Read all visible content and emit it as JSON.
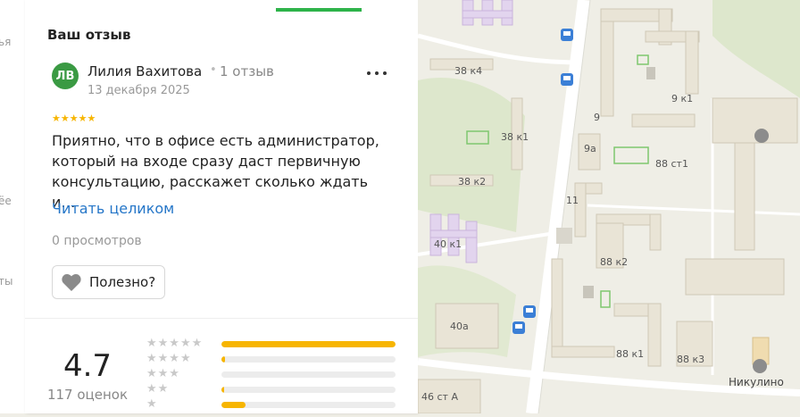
{
  "left_sliver": {
    "fragments": [
      "ья",
      "ёе",
      "ты"
    ]
  },
  "review": {
    "section_title": "Ваш отзыв",
    "avatar_initials": "ЛВ",
    "author": "Лилия Вахитова",
    "separator": "•",
    "reviews_count": "1 отзыв",
    "date": "13 декабря 2025",
    "stars": "★★★★★",
    "text": "Приятно, что в офисе есть администратор, который на входе сразу даст первичную консультацию, расскажет сколько ждать и…",
    "read_more": "Читать целиком",
    "views": "0 просмотров",
    "useful_label": "Полезно?"
  },
  "summary": {
    "rating": "4.7",
    "ratings_count": "117 оценок",
    "distribution": [
      {
        "stars": "★★★★★",
        "fill": 1.0
      },
      {
        "stars": "★★★★",
        "fill": 0.02
      },
      {
        "stars": "★★★",
        "fill": 0.0
      },
      {
        "stars": "★★",
        "fill": 0.01
      },
      {
        "stars": "★",
        "fill": 0.14
      }
    ]
  },
  "map": {
    "labels": [
      "38 к4",
      "9 к1",
      "9",
      "38 к1",
      "9а",
      "88 ст1",
      "38 к2",
      "11",
      "40 к1",
      "88 к2",
      "40а",
      "88 к1",
      "88 к3",
      "46 ст А",
      "Никулино"
    ]
  },
  "colors": {
    "accent_green": "#2eb34a",
    "star": "#f7b500",
    "link": "#2576c8",
    "avatar": "#3a9a43"
  }
}
